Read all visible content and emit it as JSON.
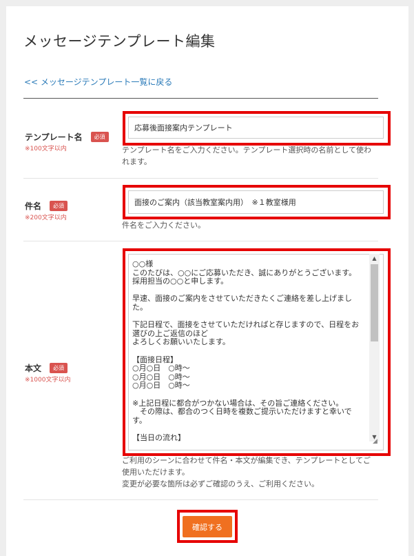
{
  "page": {
    "title": "メッセージテンプレート編集",
    "back_link": "<< メッセージテンプレート一覧に戻る"
  },
  "fields": {
    "template_name": {
      "label": "テンプレート名",
      "required_badge": "必須",
      "limit": "※100文字以内",
      "value": "応募後面接案内テンプレート",
      "help": "テンプレート名をご入力ください。テンプレート選択時の名前として使われます。"
    },
    "subject": {
      "label": "件名",
      "required_badge": "必須",
      "limit": "※200文字以内",
      "value": "面接のご案内（該当教室案内用）　※１教室様用",
      "help": "件名をご入力ください。"
    },
    "body": {
      "label": "本文",
      "required_badge": "必須",
      "limit": "※1000文字以内",
      "value": "○○様\nこのたびは、○○にご応募いただき、誠にありがとうございます。\n採用担当の○○と申します。\n\n早速、面接のご案内をさせていただきたくご連絡を差し上げました。\n\n下記日程で、面接をさせていただければと存じますので、日程をお選びの上ご返信のほど\nよろしくお願いいたします。\n\n【面接日程】\n○月○日　○時～\n○月○日　○時～\n○月○日　○時～\n\n※上記日程に都合がつかない場合は、その旨ご連絡ください。\n　その際は、都合のつく日時を複数ご提示いただけますと幸いです。\n\n【当日の流れ】\n全体の所要時間：約○○分",
      "help_1": "ご利用のシーンに合わせて件名・本文が編集でき、テンプレートとしてご使用いただけます。",
      "help_2": "変更が必要な箇所は必ずご確認のうえ、ご利用ください。"
    }
  },
  "actions": {
    "submit_label": "確認する"
  },
  "colors": {
    "highlight": "#e60000",
    "submit": "#f07020",
    "badge": "#d9534f",
    "link": "#2a7ab8"
  }
}
